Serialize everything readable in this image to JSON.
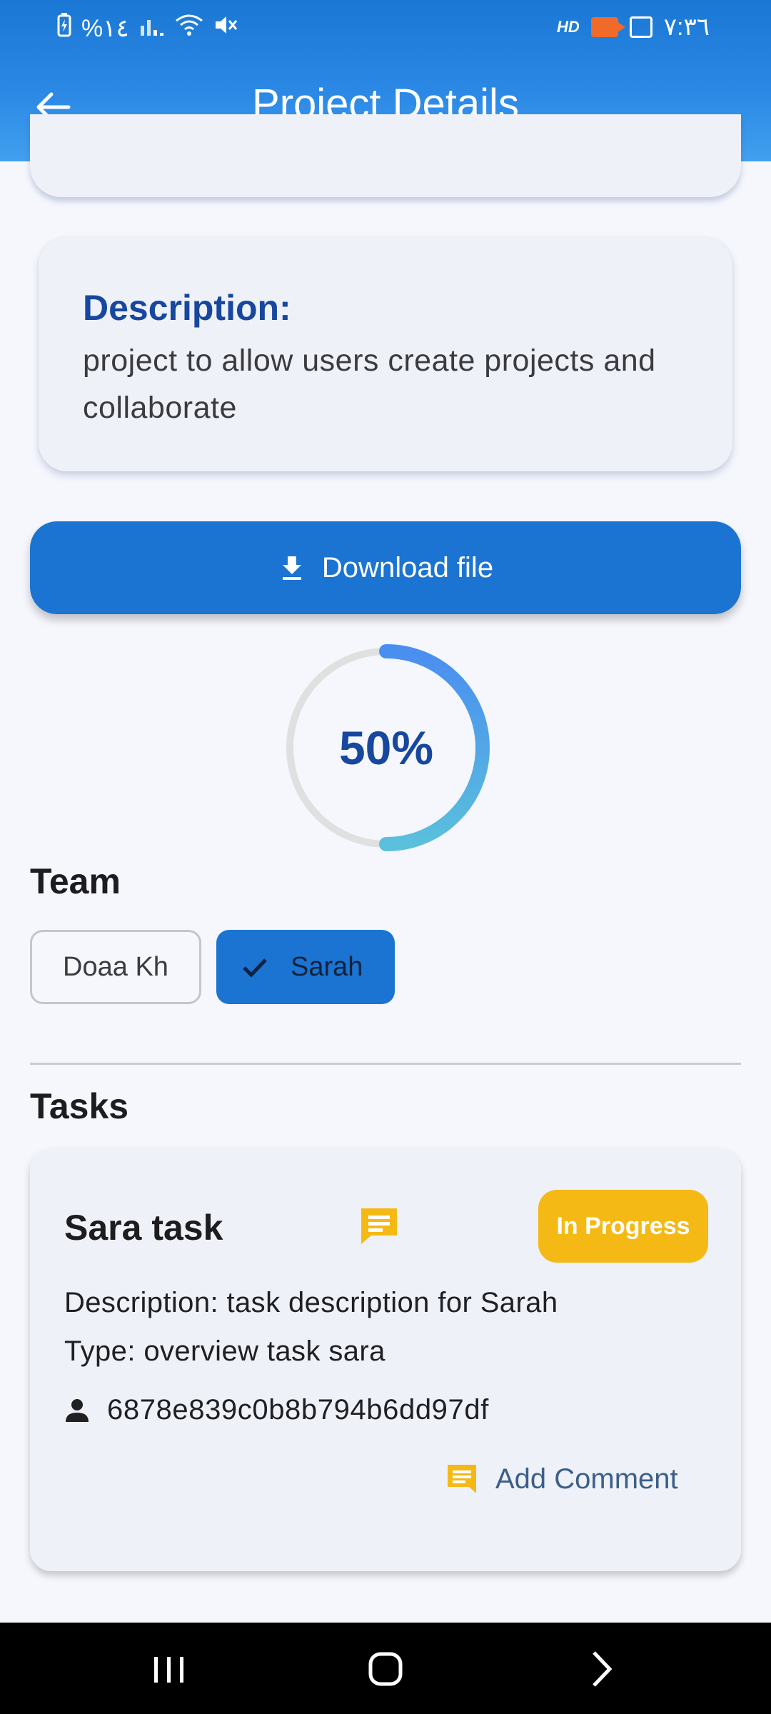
{
  "status_bar": {
    "battery": "%١٤",
    "time": "٧:٣٦",
    "hd": "HD"
  },
  "app_bar": {
    "title": "Project Details",
    "back_icon": "arrow-back-icon"
  },
  "description": {
    "label": "Description:",
    "text": "project to allow users create projects and collaborate"
  },
  "download": {
    "label": "Download file",
    "icon": "download-icon"
  },
  "progress": {
    "value": 0.5,
    "label": "50%",
    "colors": {
      "track": "#e0e0e0",
      "start": "#4a8ef0",
      "end": "#5ac0dc"
    }
  },
  "team": {
    "title": "Team",
    "members": [
      {
        "name": "Doaa Kh",
        "selected": false
      },
      {
        "name": "Sarah",
        "selected": true
      }
    ]
  },
  "tasks": {
    "title": "Tasks",
    "items": [
      {
        "title": "Sara task",
        "status": "In Progress",
        "description": "Description: task description for Sarah",
        "type": "Type: overview task sara",
        "assignee": "6878e839c0b8b794b6dd97df",
        "add_comment": "Add Comment"
      }
    ]
  },
  "colors": {
    "primary": "#1b74d2",
    "heading_blue": "#17479e",
    "status_yellow": "#f5b915"
  }
}
